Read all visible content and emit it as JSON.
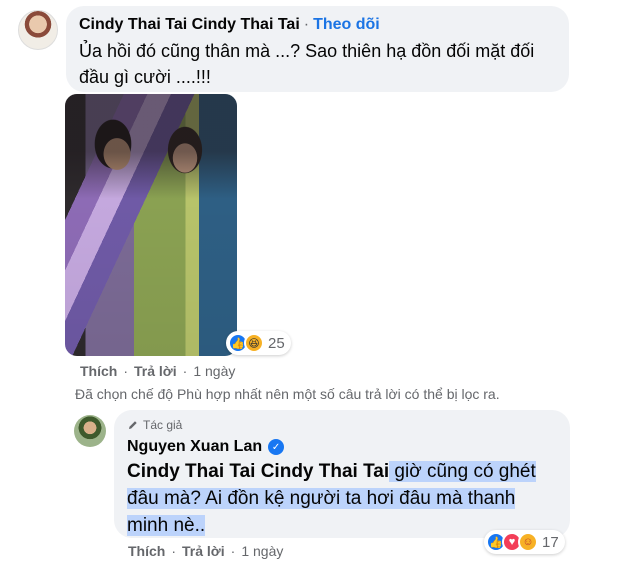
{
  "comment1": {
    "author": "Cindy Thai Tai Cindy Thai Tai",
    "separator": "·",
    "follow_label": "Theo dõi",
    "text": "Ủa hồi đó cũng thân mà ...? Sao thiên hạ đồn đối mặt đối đầu gì cười ....!!!",
    "reaction_count": "25",
    "actions": {
      "like": "Thích",
      "reply": "Trả lời",
      "separator": "·",
      "time": "1 ngày"
    },
    "reaction_icons": [
      "like-icon",
      "haha-icon"
    ]
  },
  "filter_note": "Đã chọn chế độ Phù hợp nhất nên một số câu trả lời có thể bị lọc ra.",
  "reply1": {
    "author_tag": "Tác giả",
    "author": "Nguyen Xuan Lan",
    "mention": "Cindy Thai Tai Cindy Thai Tai",
    "text": " giờ cũng có ghét đâu mà? Ai đồn kệ người ta hơi đâu mà thanh minh nè..",
    "reaction_count": "17",
    "actions": {
      "like": "Thích",
      "reply": "Trả lời",
      "separator": "·",
      "time": "1 ngày"
    },
    "reaction_icons": [
      "like-icon",
      "love-icon",
      "care-icon"
    ]
  },
  "colors": {
    "bubble": "#f0f2f5",
    "link_blue": "#1b74e4",
    "secondary_text": "#65676b",
    "highlight": "#bcd3fb"
  }
}
